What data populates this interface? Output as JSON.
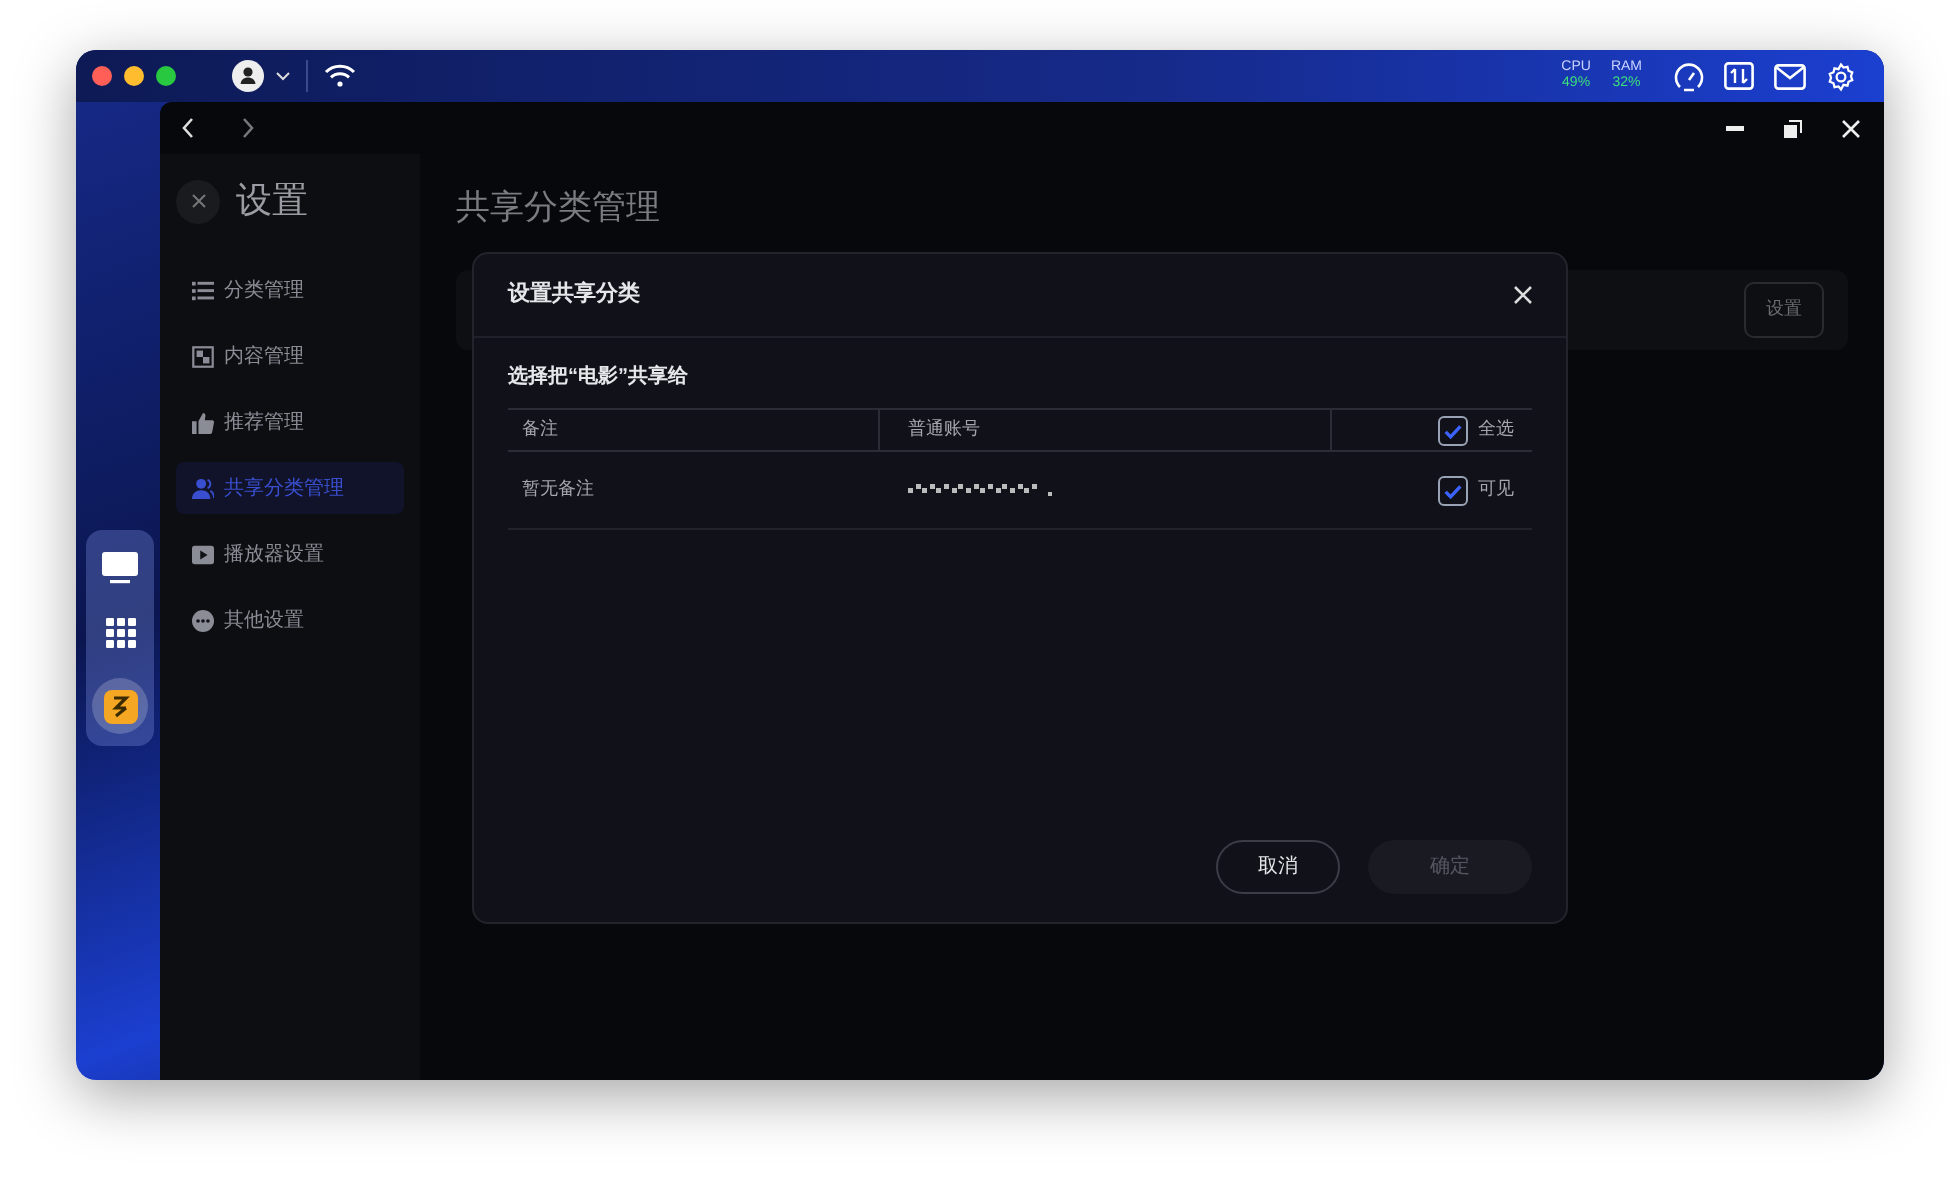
{
  "status_bar": {
    "meters": [
      {
        "label": "CPU",
        "value": "49%"
      },
      {
        "label": "RAM",
        "value": "32%"
      }
    ]
  },
  "dock": {
    "items": [
      {
        "kind": "screen",
        "selected": false
      },
      {
        "kind": "apps",
        "selected": false
      },
      {
        "kind": "app",
        "selected": true
      }
    ]
  },
  "sidebar": {
    "title": "设置",
    "items": [
      {
        "label": "分类管理",
        "selected": false
      },
      {
        "label": "内容管理",
        "selected": false
      },
      {
        "label": "推荐管理",
        "selected": false
      },
      {
        "label": "共享分类管理",
        "selected": true
      },
      {
        "label": "播放器设置",
        "selected": false
      },
      {
        "label": "其他设置",
        "selected": false
      }
    ]
  },
  "main": {
    "title": "共享分类管理",
    "card_button": "设置"
  },
  "dialog": {
    "title": "设置共享分类",
    "prompt": "选择把“电影”共享给",
    "columns": [
      "备注",
      "普通账号"
    ],
    "select_all": {
      "label": "全选",
      "checked": true
    },
    "rows": [
      {
        "note": "暂无备注",
        "visible": {
          "label": "可见",
          "checked": true
        }
      }
    ],
    "cancel": "取消",
    "confirm": {
      "label": "确定",
      "disabled": true
    }
  }
}
